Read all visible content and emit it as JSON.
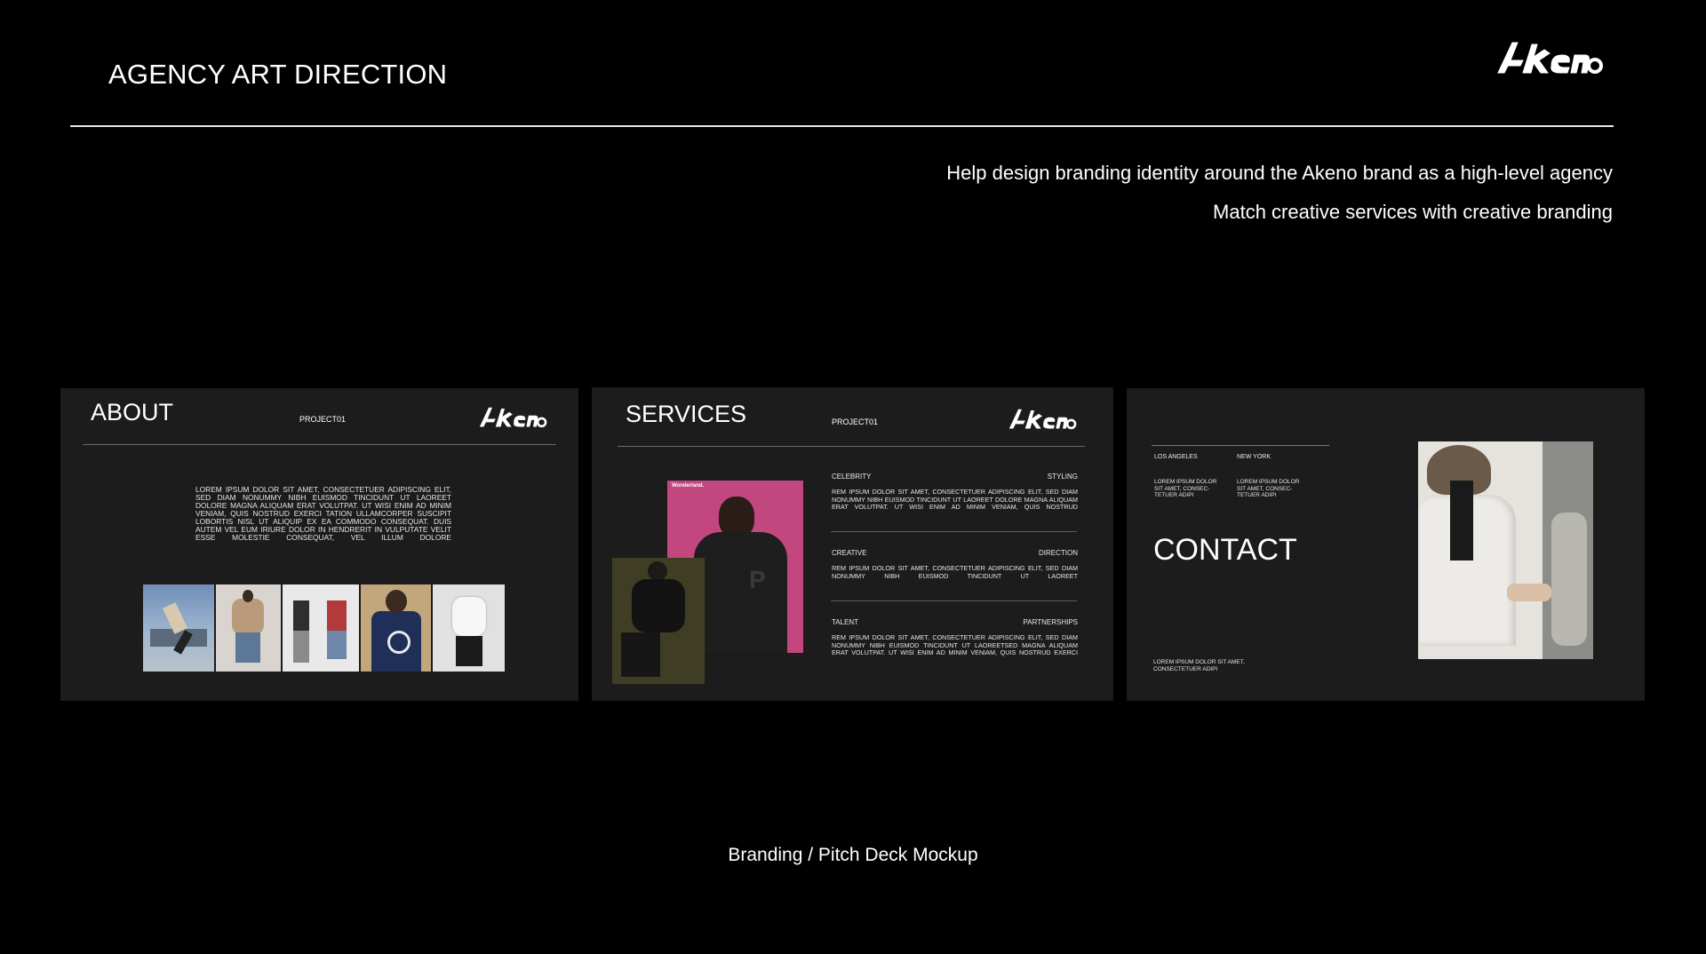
{
  "header": {
    "title": "AGENCY ART DIRECTION",
    "logo_text": "akeno"
  },
  "taglines": [
    "Help design branding identity around the Akeno brand as a high-level agency",
    "Match creative services with creative branding"
  ],
  "slides": {
    "about": {
      "title": "ABOUT",
      "project": "PROJECT01",
      "body": "LOREM IPSUM DOLOR SIT AMET, CONSECTETUER ADIPISCING ELIT, SED DIAM NONUMMY NIBH EUISMOD TINCIDUNT UT LAOREET DOLORE MAGNA ALIQUAM ERAT VOLUTPAT. UT WISI ENIM AD MINIM VENIAM, QUIS NOSTRUD EXERCI TATION ULLAMCORPER SUSCIPIT LOBORTIS NISL UT ALIQUIP EX EA COMMODO CONSEQUAT. DUIS AUTEM VEL EUM IRIURE DOLOR IN HENDRERIT IN VULPUTATE VELIT ESSE MOLESTIE CONSEQUAT, VEL ILLUM DOLORE"
    },
    "services": {
      "title": "SERVICES",
      "project": "PROJECT01",
      "magazine_label": "Wonderland.",
      "rows": [
        {
          "left": "CELEBRITY",
          "right": "STYLING",
          "body": "REM IPSUM DOLOR SIT AMET, CONSECTETUER ADIPISCING ELIT, SED DIAM NONUMMY NIBH EUISMOD TINCIDUNT UT LAOREET DOLORE MAGNA ALIQUAM ERAT VOLUTPAT. UT WISI ENIM AD MINIM VENIAM, QUIS NOSTRUD"
        },
        {
          "left": "CREATIVE",
          "right": "DIRECTION",
          "body": "REM IPSUM DOLOR SIT AMET, CONSECTETUER ADIPISCING ELIT, SED DIAM NONUMMY NIBH EUISMOD TINCIDUNT UT LAOREET"
        },
        {
          "left": "TALENT",
          "right": "PARTNERSHIPS",
          "body": "REM IPSUM DOLOR SIT AMET, CONSECTETUER ADIPISCING ELIT, SED DIAM NONUMMY NIBH EUISMOD TINCIDUNT UT LAOREETSED MAGNA ALIQUAM ERAT VOLUTPAT. UT WISI ENIM AD MINIM VENIAM, QUIS NOSTRUD EXERCI"
        }
      ]
    },
    "contact": {
      "title": "CONTACT",
      "city_1": "LOS ANGELES",
      "city_2": "NEW YORK",
      "city_1_body": "LOREM IPSUM DOLOR SIT AMET, CONSEC- TETUER ADIPI",
      "city_2_body": "LOREM IPSUM DOLOR SIT AMET, CONSEC- TETUER ADIPI",
      "footer": "LOREM IPSUM DOLOR SIT AMET, CONSECTETUER ADIPI"
    }
  },
  "caption": "Branding / Pitch Deck Mockup",
  "colors": {
    "background": "#000000",
    "slide_bg": "#1c1c1c",
    "text": "#ffffff",
    "magazine_pink": "#c2477f"
  }
}
